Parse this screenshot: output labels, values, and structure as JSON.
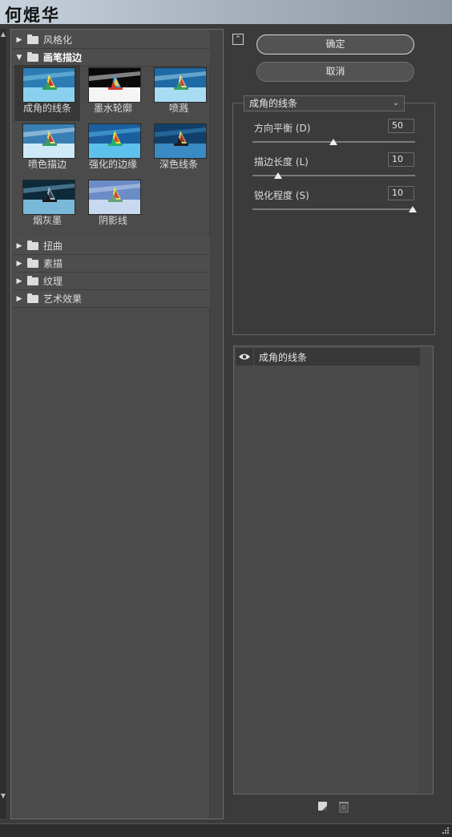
{
  "window": {
    "brand_text": "何焜华"
  },
  "gallery": {
    "categories_before": [
      {
        "label": "风格化",
        "expanded": false
      }
    ],
    "open_category": {
      "label": "画笔描边",
      "expanded": true
    },
    "thumbnails": [
      {
        "label": "成角的线条",
        "selected": true
      },
      {
        "label": "墨水轮廓",
        "selected": false
      },
      {
        "label": "喷溅",
        "selected": false
      },
      {
        "label": "喷色描边",
        "selected": false
      },
      {
        "label": "强化的边缘",
        "selected": false
      },
      {
        "label": "深色线条",
        "selected": false
      },
      {
        "label": "烟灰墨",
        "selected": false
      },
      {
        "label": "阴影线",
        "selected": false
      }
    ],
    "categories_after": [
      {
        "label": "扭曲"
      },
      {
        "label": "素描"
      },
      {
        "label": "纹理"
      },
      {
        "label": "艺术效果"
      }
    ]
  },
  "actions": {
    "ok_label": "确定",
    "cancel_label": "取消"
  },
  "settings": {
    "selected_filter": "成角的线条",
    "params": [
      {
        "label": "方向平衡 (D)",
        "value": "50",
        "fraction": 0.5
      },
      {
        "label": "描边长度 (L)",
        "value": "10",
        "fraction": 0.15
      },
      {
        "label": "锐化程度 (S)",
        "value": "10",
        "fraction": 1.0
      }
    ]
  },
  "layers": {
    "items": [
      {
        "label": "成角的线条",
        "visible": true
      }
    ]
  },
  "icons": {
    "collapse": "collapse-up-icon",
    "eye": "eye-icon",
    "new_layer": "new-effect-layer-icon",
    "delete": "trash-icon",
    "folder": "folder-icon",
    "grip": "resize-grip-icon"
  }
}
